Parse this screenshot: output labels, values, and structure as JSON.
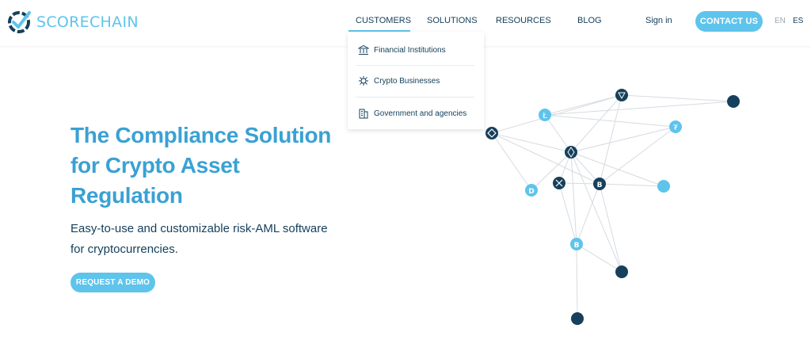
{
  "brand": {
    "name": "SCORECHAIN"
  },
  "nav": {
    "items": [
      {
        "label": "CUSTOMERS",
        "active": true
      },
      {
        "label": "SOLUTIONS"
      },
      {
        "label": "RESOURCES"
      },
      {
        "label": "BLOG"
      }
    ],
    "signin": "Sign in",
    "contact": "CONTACT US",
    "languages": [
      "EN",
      "ES"
    ]
  },
  "dropdown": {
    "items": [
      {
        "label": "Financial Institutions",
        "icon": "bank-icon"
      },
      {
        "label": "Crypto Businesses",
        "icon": "network-gear-icon"
      },
      {
        "label": "Government and agencies",
        "icon": "building-icon"
      }
    ]
  },
  "hero": {
    "title": "The Compliance Solution for Crypto Asset Regulation",
    "subtitle": "Easy-to-use and customizable risk-AML software for cryptocurrencies.",
    "cta": "REQUEST A DEMO"
  },
  "colors": {
    "accent": "#5ec4ec",
    "title": "#3aa1d4",
    "dark": "#16405b",
    "edge": "#d6dbe0"
  }
}
